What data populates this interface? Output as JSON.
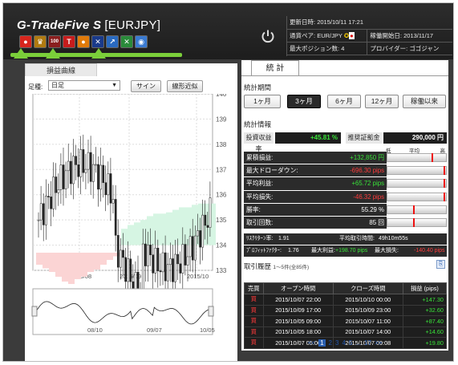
{
  "header": {
    "title": "G-TradeFive S",
    "pair": "[EURJPY]",
    "update_label": "更新日時:",
    "update_value": "2015/10/11 17:21",
    "pair_label": "通貨ペア:",
    "pair_value": "EUR/JPY",
    "start_label": "稼働開始日:",
    "start_value": "2013/11/17",
    "maxpos_label": "最大ポジション数:",
    "maxpos_value": "4",
    "provider_label": "プロバイダー:",
    "provider_value": "ゴゴジャン"
  },
  "toolbar_icons": [
    {
      "name": "red-circle-icon",
      "color": "#d8261d",
      "glyph": "●"
    },
    {
      "name": "crown-icon",
      "color": "#b07a10",
      "glyph": "♛"
    },
    {
      "name": "top100-icon",
      "color": "#8a1e1e",
      "glyph": "100"
    },
    {
      "name": "t100-icon",
      "color": "#c71c1c",
      "glyph": "T"
    },
    {
      "name": "fire-icon",
      "color": "#e07a0a",
      "glyph": "●"
    },
    {
      "name": "flag-icon",
      "color": "#1a3a8a",
      "glyph": "✕"
    },
    {
      "name": "trend-icon",
      "color": "#2a6ac0",
      "glyph": "↗"
    },
    {
      "name": "arrows-icon",
      "color": "#2a8a3a",
      "glyph": "✕"
    },
    {
      "name": "globe-icon",
      "color": "#3a7ad0",
      "glyph": "◉"
    }
  ],
  "left": {
    "tab": "損益曲線",
    "foot_label": "足種:",
    "foot_value": "日足",
    "sine_btn": "サイン",
    "linear_btn": "線形近似"
  },
  "chart_data": {
    "type": "candlestick",
    "ylim": [
      133,
      140
    ],
    "yticks": [
      "140",
      "139",
      "138",
      "137",
      "136",
      "135",
      "134",
      "133"
    ],
    "xticks": [
      "2015/08",
      "2015/09",
      "2015/10"
    ],
    "nav_ticks": [
      "08/10",
      "09/07",
      "10/05"
    ]
  },
  "right": {
    "tab": "統 計",
    "period_label": "統計期間",
    "periods": [
      "1ヶ月",
      "3ヶ月",
      "6ヶ月",
      "12ヶ月",
      "稼働以来"
    ],
    "active_period": "3ヶ月",
    "stats_label": "統計情報",
    "roi_label": "投資収益率",
    "roi_value": "+45.81 %",
    "margin_label": "推奨証拠金",
    "margin_value": "290,000 円",
    "scale_low": "低",
    "scale_mid": "平均",
    "scale_high": "高",
    "rows": [
      {
        "k": "累積損益:",
        "v": "+132,850 円",
        "c": "#39e339",
        "m": 0.78
      },
      {
        "k": "最大ドローダウン:",
        "v": "-696.30 pips",
        "c": "#ff3b3b",
        "m": 0.99
      },
      {
        "k": "平均利益:",
        "v": "+65.72 pips",
        "c": "#39e339",
        "m": 0.99
      },
      {
        "k": "平均損失:",
        "v": "-46.32 pips",
        "c": "#ff3b3b",
        "m": 0.99
      },
      {
        "k": "勝率:",
        "v": "55.29 %",
        "c": "#fff",
        "m": 0.45
      },
      {
        "k": "取引回数:",
        "v": "85 回",
        "c": "#fff",
        "m": 0.45
      }
    ],
    "risk_return_label": "ﾘｽｸﾘﾀｰﾝ率:",
    "risk_return_value": "1.91",
    "avg_hold_label": "平均取引時間:",
    "avg_hold_value": "49h10m55s",
    "pf_label": "ﾌﾟﾛﾌｨｯﾄﾌｧｸﾀｰ:",
    "pf_value": "1.76",
    "max_profit_label": "最大利益:",
    "max_profit_value": "+198.70 pips",
    "max_loss_label": "最大損失:",
    "max_loss_value": "-140.40 pips",
    "history_label": "取引履歴",
    "history_range": "1～5件(全85件)",
    "history_headers": [
      "売買",
      "オープン時間",
      "クローズ時間",
      "損益 (pips)"
    ],
    "history_rows": [
      [
        "買",
        "2015/10/07 22:00",
        "2015/10/10 00:00",
        "+147.30"
      ],
      [
        "買",
        "2015/10/09 17:00",
        "2015/10/09 23:00",
        "+32.60"
      ],
      [
        "買",
        "2015/10/05 09:00",
        "2015/10/07 11:00",
        "+87.40"
      ],
      [
        "買",
        "2015/10/05 18:00",
        "2015/10/07 14:00",
        "+14.60"
      ],
      [
        "買",
        "2015/10/07 05:00",
        "2015/10/07 09:08",
        "+19.80"
      ]
    ],
    "pager": [
      "<<",
      "1",
      "2",
      "3",
      "4",
      "5",
      "...",
      "17",
      ">>"
    ],
    "pager_current": "1"
  }
}
